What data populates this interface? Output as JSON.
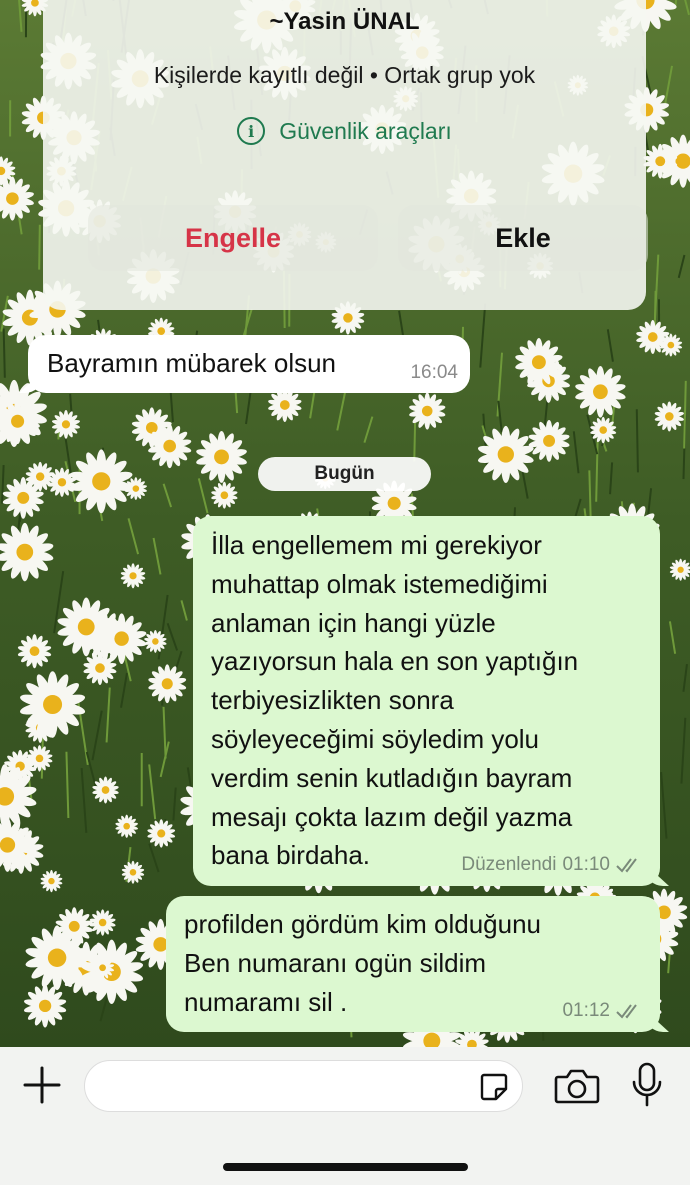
{
  "contact_card": {
    "name": "~Yasin ÜNAL",
    "subtitle": "Kişilerde kayıtlı değil • Ortak grup yok",
    "security_label": "Güvenlik araçları",
    "block_label": "Engelle",
    "add_label": "Ekle"
  },
  "messages_earlier": [
    {
      "text": "Bayramın mübarek olsun",
      "time": "16:04",
      "direction": "incoming"
    }
  ],
  "date_separator": "Bugün",
  "messages_today": [
    {
      "lines": [
        "İlla engellemem mi gerekiyor",
        "muhattap olmak istemediğimi",
        "anlaman için hangi  yüzle",
        "yazıyorsun hala en son yaptığın",
        "terbiyesizlikten sonra",
        "söyleyeceğimi söyledim yolu",
        "verdim  senin kutladığın bayram",
        "mesajı çokta lazım değil yazma",
        "bana birdaha."
      ],
      "edited_label": "Düzenlendi",
      "time": "01:10",
      "direction": "outgoing",
      "status": "read"
    },
    {
      "lines": [
        "profilden gördüm kim olduğunu",
        "Ben numaranı ogün sildim",
        "numaramı sil ."
      ],
      "time": "01:12",
      "direction": "outgoing",
      "status": "read"
    }
  ],
  "composer": {
    "placeholder": "",
    "icons": [
      "plus-icon",
      "sticker-icon",
      "camera-icon",
      "mic-icon"
    ]
  },
  "colors": {
    "outgoing_bubble": "#dcf8d0",
    "incoming_bubble": "#ffffff",
    "block_red": "#d63447",
    "security_green": "#1f7a4f"
  }
}
